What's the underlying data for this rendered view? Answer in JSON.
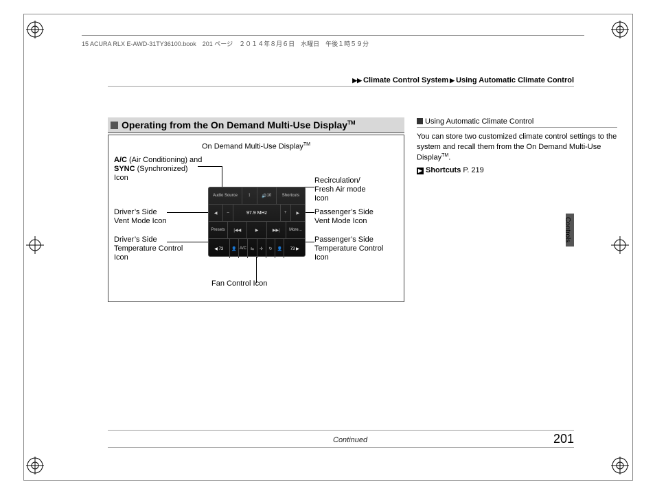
{
  "header_line": "15 ACURA RLX E-AWD-31TY36100.book　201 ページ　２０１４年８月６日　水曜日　午後１時５９分",
  "breadcrumb": {
    "a": "Climate Control System",
    "b": "Using Automatic Climate Control"
  },
  "section_title": "Operating from the On Demand Multi-Use Display",
  "section_tm": "TM",
  "fig_title": "On Demand Multi-Use Display",
  "fig_tm": "TM",
  "callouts": {
    "ac_line1": "A/C",
    "ac_line1b": " (Air Conditioning) and",
    "ac_line2": "SYNC",
    "ac_line2b": " (Synchronized) Icon",
    "driver_vent": "Driver’s Side\nVent Mode Icon",
    "driver_temp": "Driver’s Side\nTemperature Control\nIcon",
    "fan": "Fan Control Icon",
    "recirc": "Recirculation/\nFresh Air mode\nIcon",
    "pass_vent": "Passenger’s Side\nVent Mode Icon",
    "pass_temp": "Passenger’s Side\nTemperature Control\nIcon"
  },
  "screen": {
    "top": {
      "audio": "Audio Source",
      "vol": "10",
      "shortcuts": "Shortcuts"
    },
    "mid": {
      "freq": "97.9 MHz"
    },
    "row3": {
      "presets": "Presets",
      "prev": "|◀◀",
      "play": "▶",
      "next": "▶▶|",
      "more": "More..."
    },
    "bottom": {
      "tl": "◀ 73",
      "tr": "73 ▶"
    }
  },
  "continued": "Continued",
  "right": {
    "head": "Using Automatic Climate Control",
    "body1": "You can store two customized climate control settings to the system and recall them from the On Demand Multi-Use Display",
    "tm": "TM",
    "period": ".",
    "link_label": "Shortcuts",
    "link_page": "P. 219"
  },
  "side_label": "Controls",
  "page_number": "201"
}
